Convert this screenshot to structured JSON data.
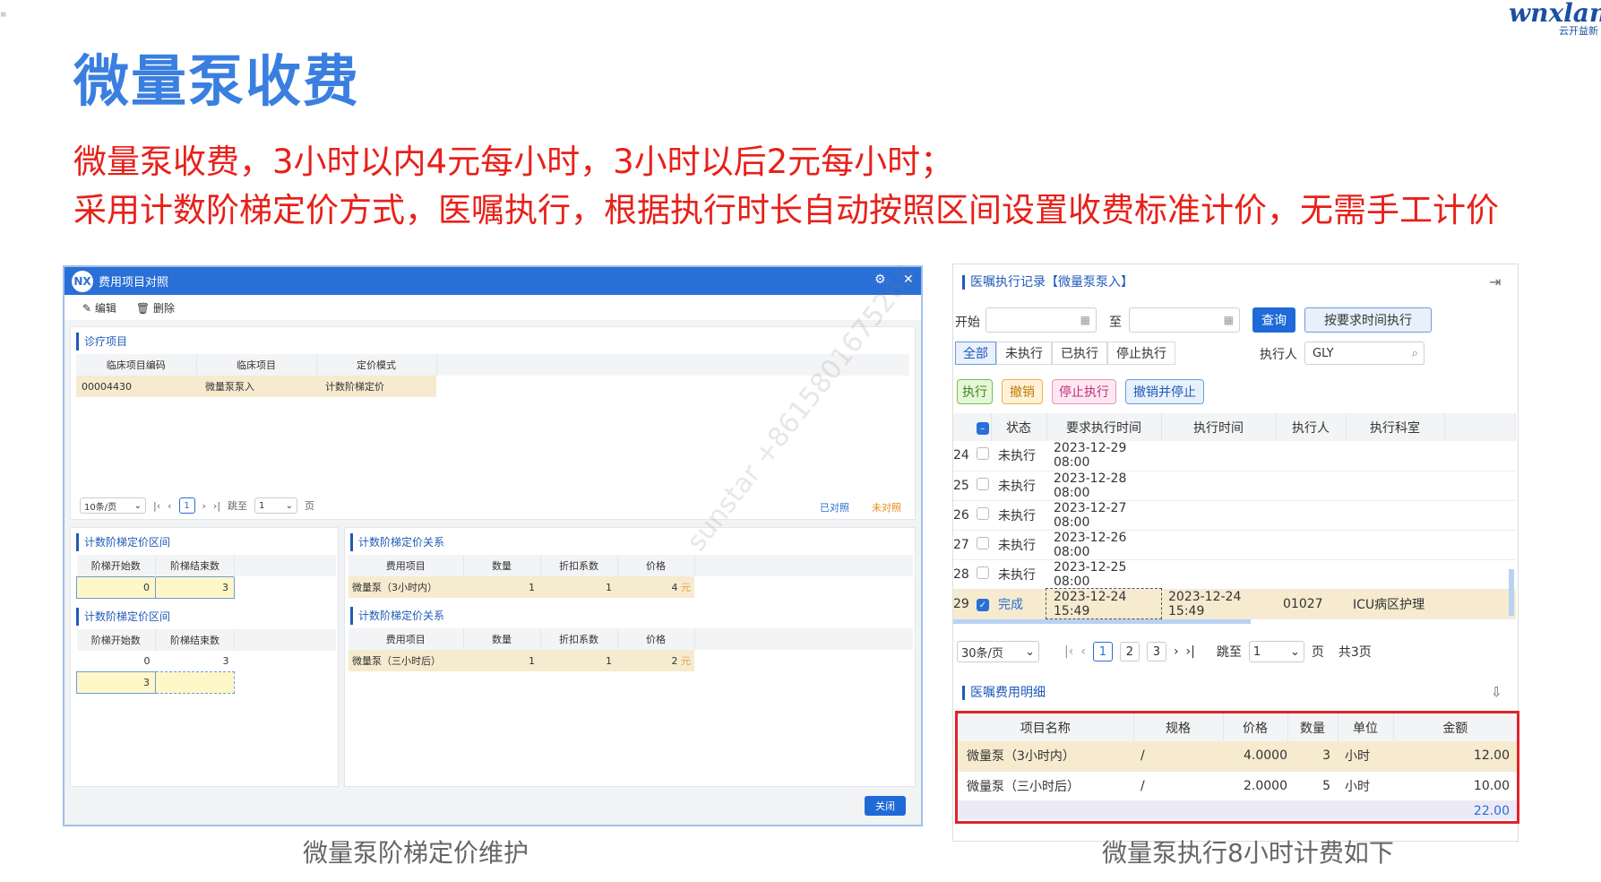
{
  "slide": {
    "title": "微量泵收费",
    "line1": "微量泵收费，3小时以内4元每小时，3小时以后2元每小时；",
    "line2": "采用计数阶梯定价方式，医嘱执行，根据执行时长自动按照区间设置收费标准计价，无需手工计价",
    "logo": "wnxland",
    "logo_sub": "云开益新",
    "caption_left": "微量泵阶梯定价维护",
    "caption_right": "微量泵执行8小时计费如下",
    "watermark": "sunstar +8615801675265",
    "corner_mark": "≡"
  },
  "left": {
    "badge": "NX",
    "title": "费用项目对照",
    "toolbar": {
      "edit": "编辑",
      "delete": "删除"
    },
    "diag": {
      "title": "诊疗项目",
      "headers": [
        "临床项目编码",
        "临床项目",
        "定价模式"
      ],
      "row": [
        "00004430",
        "微量泵泵入",
        "计数阶梯定价"
      ],
      "pager": {
        "size": "10条/页",
        "page": "1",
        "jump": "跳至",
        "jump_val": "1",
        "unit": "页",
        "mapped": "已对照",
        "unmapped": "未对照"
      }
    },
    "range1": {
      "title": "计数阶梯定价区间",
      "headers": [
        "阶梯开始数",
        "阶梯结束数"
      ],
      "row": [
        "0",
        "3"
      ]
    },
    "rel1": {
      "title": "计数阶梯定价关系",
      "headers": [
        "费用项目",
        "数量",
        "折扣系数",
        "价格"
      ],
      "row": [
        "微量泵（3小时内）",
        "1",
        "1",
        "4"
      ],
      "unit": "元"
    },
    "range2": {
      "title": "计数阶梯定价区间",
      "headers": [
        "阶梯开始数",
        "阶梯结束数"
      ],
      "rows": [
        [
          "0",
          "3"
        ],
        [
          "3",
          ""
        ]
      ]
    },
    "rel2": {
      "title": "计数阶梯定价关系",
      "headers": [
        "费用项目",
        "数量",
        "折扣系数",
        "价格"
      ],
      "row": [
        "微量泵（三小时后）",
        "1",
        "1",
        "2"
      ],
      "unit": "元"
    },
    "close": "关闭"
  },
  "right": {
    "title": "医嘱执行记录【微量泵泵入】",
    "start_label": "开始",
    "to_label": "至",
    "query": "查询",
    "exec_by_time": "按要求时间执行",
    "tabs": [
      "全部",
      "未执行",
      "已执行",
      "停止执行"
    ],
    "executor_label": "执行人",
    "executor_val": "GLY",
    "actions": [
      "执行",
      "撤销",
      "停止执行",
      "撤销并停止"
    ],
    "headers": [
      "状态",
      "要求执行时间",
      "执行时间",
      "执行人",
      "执行科室"
    ],
    "rows": [
      {
        "n": "24",
        "status": "未执行",
        "req": "2023-12-29 08:00",
        "exec": "",
        "who": "",
        "dept": ""
      },
      {
        "n": "25",
        "status": "未执行",
        "req": "2023-12-28 08:00",
        "exec": "",
        "who": "",
        "dept": ""
      },
      {
        "n": "26",
        "status": "未执行",
        "req": "2023-12-27 08:00",
        "exec": "",
        "who": "",
        "dept": ""
      },
      {
        "n": "27",
        "status": "未执行",
        "req": "2023-12-26 08:00",
        "exec": "",
        "who": "",
        "dept": ""
      },
      {
        "n": "28",
        "status": "未执行",
        "req": "2023-12-25 08:00",
        "exec": "",
        "who": "",
        "dept": ""
      },
      {
        "n": "29",
        "status": "完成",
        "req": "2023-12-24 15:49",
        "exec": "2023-12-24 15:49",
        "who": "01027",
        "dept": "ICU病区护理"
      }
    ],
    "pager": {
      "size": "30条/页",
      "pages": [
        "1",
        "2",
        "3"
      ],
      "jump": "跳至",
      "jump_val": "1",
      "unit": "页",
      "total": "共3页"
    },
    "fee": {
      "title": "医嘱费用明细",
      "headers": [
        "项目名称",
        "规格",
        "价格",
        "数量",
        "单位",
        "金额"
      ],
      "rows": [
        [
          "微量泵（3小时内）",
          "/",
          "4.0000",
          "3",
          "小时",
          "12.00"
        ],
        [
          "微量泵（三小时后）",
          "/",
          "2.0000",
          "5",
          "小时",
          "10.00"
        ]
      ],
      "total": "22.00"
    }
  }
}
